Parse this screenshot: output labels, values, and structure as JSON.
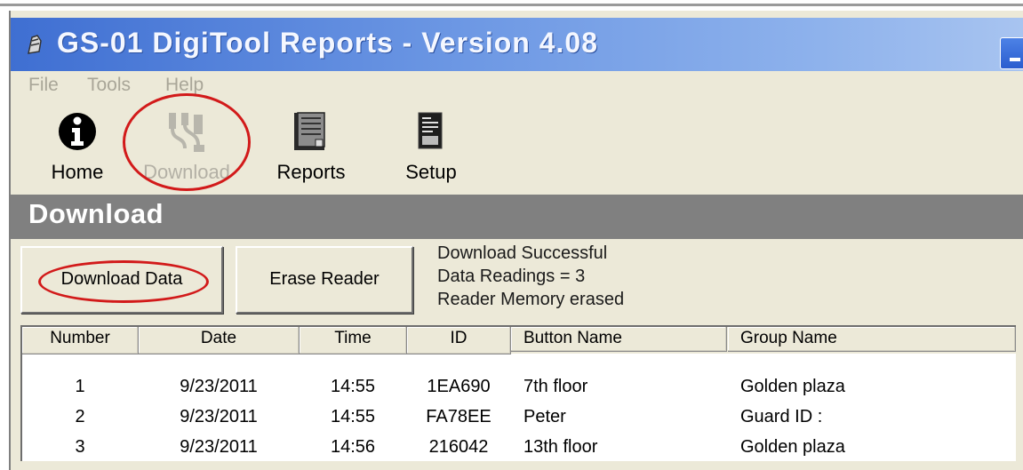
{
  "window": {
    "title": "GS-01 DigiTool Reports - Version 4.08"
  },
  "menu": {
    "items": [
      "File",
      "Tools",
      "Help"
    ]
  },
  "toolbar": {
    "items": [
      {
        "label": "Home",
        "icon": "info-icon",
        "enabled": true
      },
      {
        "label": "Download",
        "icon": "download-cable-icon",
        "enabled": false
      },
      {
        "label": "Reports",
        "icon": "reports-book-icon",
        "enabled": true
      },
      {
        "label": "Setup",
        "icon": "setup-device-icon",
        "enabled": true
      }
    ]
  },
  "section": {
    "title": "Download"
  },
  "actions": {
    "download_data": "Download Data",
    "erase_reader": "Erase Reader"
  },
  "status": {
    "lines": [
      "Download Successful",
      "Data Readings = 3",
      "Reader Memory erased"
    ]
  },
  "table": {
    "columns": [
      "Number",
      "Date",
      "Time",
      "ID",
      "Button Name",
      "Group Name"
    ],
    "rows": [
      [
        "1",
        "9/23/2011",
        "14:55",
        "1EA690",
        "7th floor",
        "Golden plaza"
      ],
      [
        "2",
        "9/23/2011",
        "14:55",
        "FA78EE",
        "Peter",
        "Guard ID :"
      ],
      [
        "3",
        "9/23/2011",
        "14:56",
        "216042",
        "13th floor",
        "Golden plaza"
      ]
    ]
  },
  "annotation": {
    "highlight_color": "#d21a1a"
  }
}
